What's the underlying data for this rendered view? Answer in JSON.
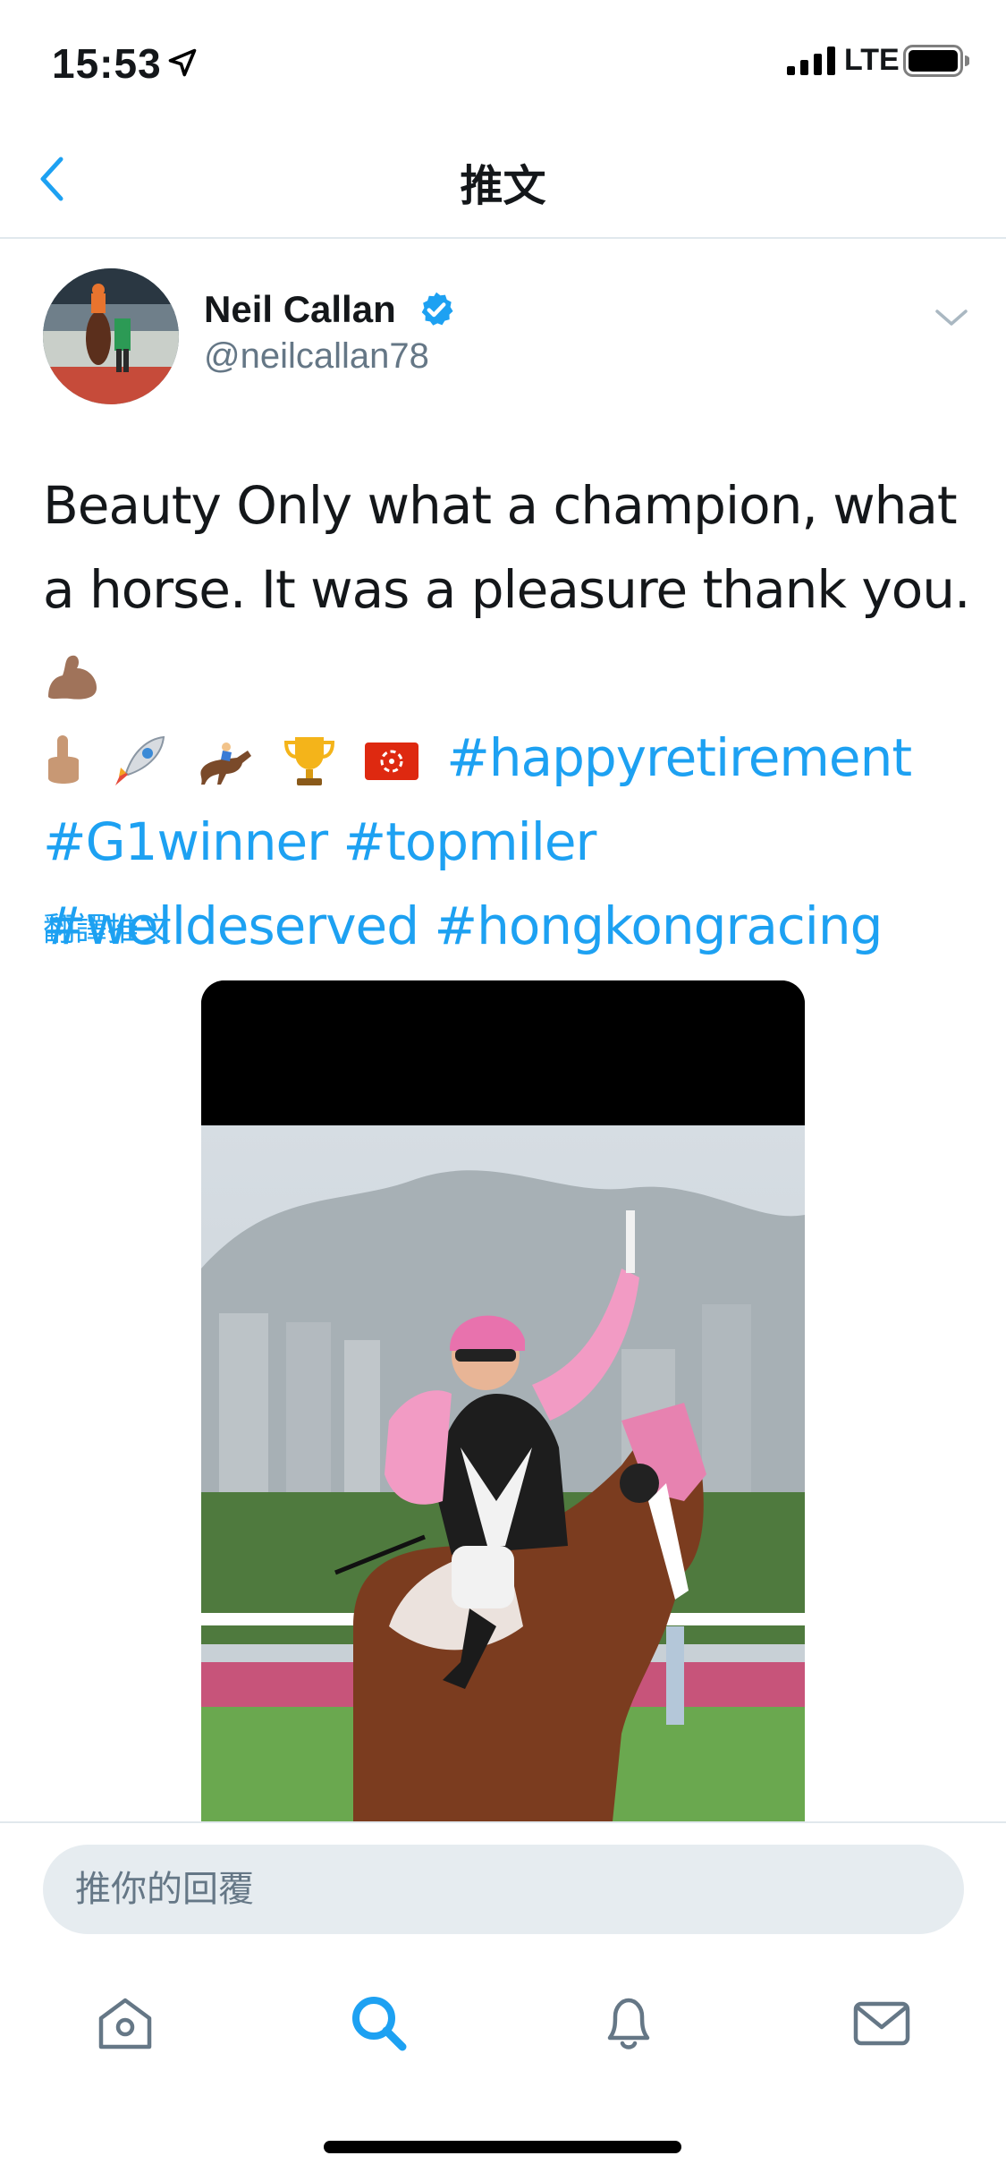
{
  "status_bar": {
    "time": "15:53",
    "network": "LTE"
  },
  "nav": {
    "title": "推文"
  },
  "author": {
    "name": "Neil Callan",
    "handle": "@neilcallan78"
  },
  "tweet": {
    "text_part1": "Beauty Only what a champion, what a horse. It was a pleasure thank you.",
    "hashtags": [
      "#happyretirement",
      "#G1winner",
      "#topmiler",
      "#welldeserved",
      "#hongkongracing"
    ],
    "translate_label": "翻譯推文"
  },
  "reply": {
    "placeholder": "推你的回覆"
  },
  "tab_bar": {
    "items": [
      "home-icon",
      "search-icon",
      "notifications-icon",
      "messages-icon"
    ],
    "active": "search-icon"
  },
  "colors": {
    "accent": "#1da1f2",
    "text": "#14171a",
    "secondary": "#657786"
  }
}
